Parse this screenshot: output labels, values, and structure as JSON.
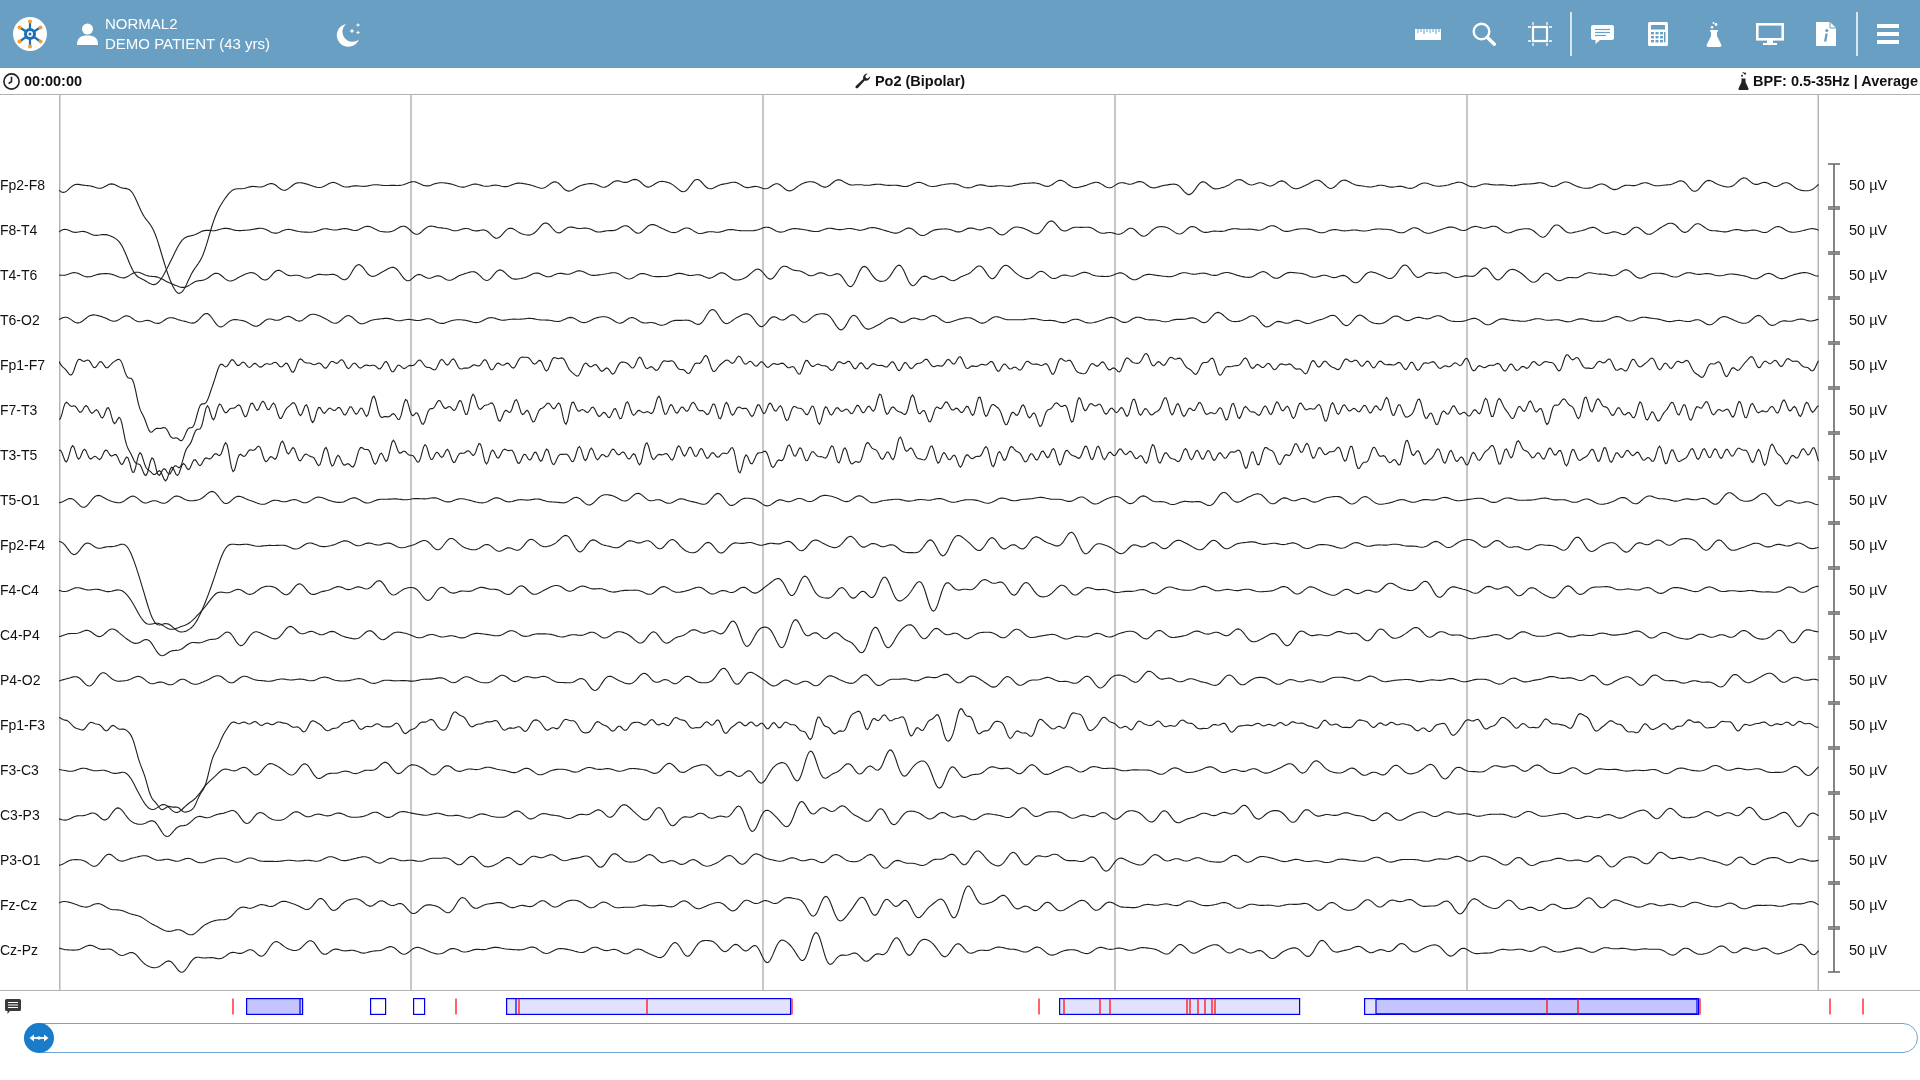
{
  "header": {
    "record": "NORMAL2",
    "patient": "DEMO PATIENT (43 yrs)"
  },
  "status_bar": {
    "time": "00:00:00",
    "montage": "Po2 (Bipolar)",
    "filter": "BPF: 0.5-35Hz | Average"
  },
  "channels": [
    {
      "label": "Fp2-F8",
      "scale": "50 µV"
    },
    {
      "label": "F8-T4",
      "scale": "50 µV"
    },
    {
      "label": "T4-T6",
      "scale": "50 µV"
    },
    {
      "label": "T6-O2",
      "scale": "50 µV"
    },
    {
      "label": "Fp1-F7",
      "scale": "50 µV"
    },
    {
      "label": "F7-T3",
      "scale": "50 µV"
    },
    {
      "label": "T3-T5",
      "scale": "50 µV"
    },
    {
      "label": "T5-O1",
      "scale": "50 µV"
    },
    {
      "label": "Fp2-F4",
      "scale": "50 µV"
    },
    {
      "label": "F4-C4",
      "scale": "50 µV"
    },
    {
      "label": "C4-P4",
      "scale": "50 µV"
    },
    {
      "label": "P4-O2",
      "scale": "50 µV"
    },
    {
      "label": "Fp1-F3",
      "scale": "50 µV"
    },
    {
      "label": "F3-C3",
      "scale": "50 µV"
    },
    {
      "label": "C3-P3",
      "scale": "50 µV"
    },
    {
      "label": "P3-O1",
      "scale": "50 µV"
    },
    {
      "label": "Fz-Cz",
      "scale": "50 µV"
    },
    {
      "label": "Cz-Pz",
      "scale": "50 µV"
    }
  ],
  "timeline": {
    "level": 0
  }
}
